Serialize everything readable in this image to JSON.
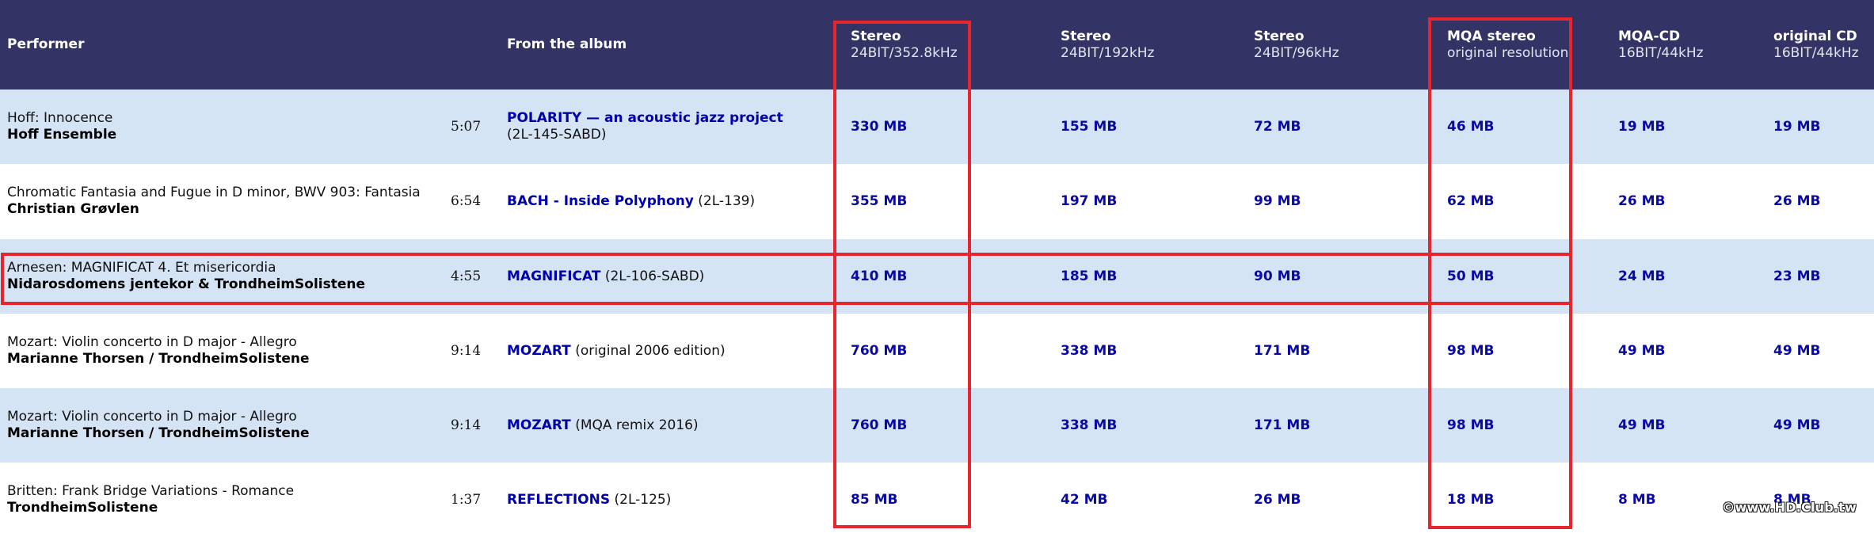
{
  "header": {
    "performer": "Performer",
    "album": "From the album",
    "formats": [
      {
        "main": "Stereo",
        "sub": "24BIT/352.8kHz"
      },
      {
        "main": "Stereo",
        "sub": "24BIT/192kHz"
      },
      {
        "main": "Stereo",
        "sub": "24BIT/96kHz"
      },
      {
        "main": "MQA stereo",
        "sub": "original resolution"
      },
      {
        "main": "MQA-CD",
        "sub": "16BIT/44kHz"
      },
      {
        "main": "original CD",
        "sub": "16BIT/44kHz"
      }
    ]
  },
  "rows": [
    {
      "title": "Hoff: Innocence",
      "performer": "Hoff Ensemble",
      "duration": "5:07",
      "album": "POLARITY — an acoustic jazz project",
      "album_code": "(2L-145-SABD)",
      "sizes": [
        "330 MB",
        "155 MB",
        "72 MB",
        "46 MB",
        "19 MB",
        "19 MB"
      ]
    },
    {
      "title": "Chromatic Fantasia and Fugue in D minor, BWV 903: Fantasia",
      "performer": "Christian Grøvlen",
      "duration": "6:54",
      "album": "BACH - Inside Polyphony",
      "album_code": "(2L-139)",
      "sizes": [
        "355 MB",
        "197 MB",
        "99 MB",
        "62 MB",
        "26 MB",
        "26 MB"
      ]
    },
    {
      "title": "Arnesen: MAGNIFICAT 4. Et misericordia",
      "performer": "Nidarosdomens jentekor & TrondheimSolistene",
      "duration": "4:55",
      "album": "MAGNIFICAT",
      "album_code": "(2L-106-SABD)",
      "sizes": [
        "410 MB",
        "185 MB",
        "90 MB",
        "50 MB",
        "24 MB",
        "23 MB"
      ]
    },
    {
      "title": "Mozart: Violin concerto in D major - Allegro",
      "performer": "Marianne Thorsen / TrondheimSolistene",
      "duration": "9:14",
      "album": "MOZART",
      "album_code": "(original 2006 edition)",
      "sizes": [
        "760 MB",
        "338 MB",
        "171 MB",
        "98 MB",
        "49 MB",
        "49 MB"
      ]
    },
    {
      "title": "Mozart: Violin concerto in D major - Allegro",
      "performer": "Marianne Thorsen / TrondheimSolistene",
      "duration": "9:14",
      "album": "MOZART",
      "album_code": "(MQA remix 2016)",
      "sizes": [
        "760 MB",
        "338 MB",
        "171 MB",
        "98 MB",
        "49 MB",
        "49 MB"
      ]
    },
    {
      "title": "Britten: Frank Bridge Variations - Romance",
      "performer": "TrondheimSolistene",
      "duration": "1:37",
      "album": "REFLECTIONS",
      "album_code": "(2L-125)",
      "sizes": [
        "85 MB",
        "42 MB",
        "26 MB",
        "18 MB",
        "8 MB",
        "8 MB"
      ]
    }
  ],
  "watermark": "©www.HD.Club.tw",
  "colors": {
    "header_bg": "#333366",
    "row_alt_bg": "#d5e4f5",
    "link": "#0000aa",
    "highlight": "#e8242c"
  }
}
